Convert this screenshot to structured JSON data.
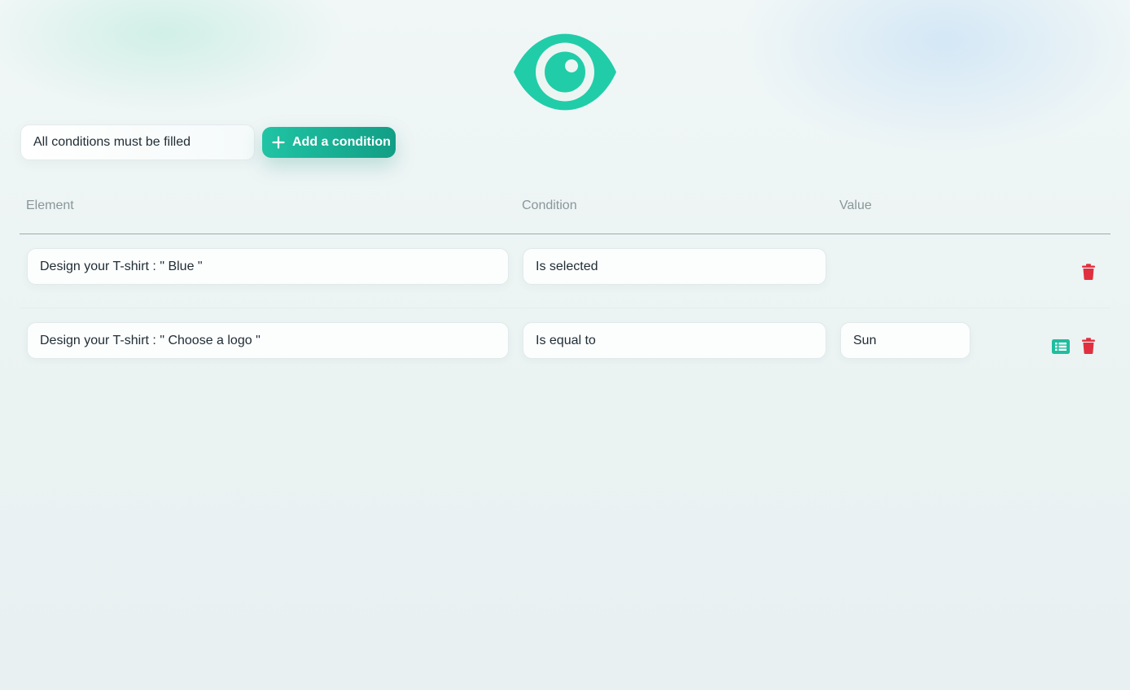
{
  "header": {
    "icon": "eye-icon",
    "icon_color": "#20cda8"
  },
  "toolbar": {
    "match_mode": "All conditions must be filled",
    "add_label": "Add a condition",
    "add_icon": "plus-icon"
  },
  "table": {
    "columns": [
      "Element",
      "Condition",
      "Value"
    ],
    "rows": [
      {
        "element": "Design your T-shirt : \" Blue \"",
        "condition": "Is selected",
        "value": null,
        "actions": [
          "trash-icon"
        ]
      },
      {
        "element": "Design your T-shirt : \" Choose a logo \"",
        "condition": "Is equal to",
        "value": "Sun",
        "actions": [
          "list-icon",
          "trash-icon"
        ]
      }
    ]
  },
  "colors": {
    "accent": "#1fbd9f",
    "danger": "#e0303f",
    "muted_text": "#8a9699"
  }
}
